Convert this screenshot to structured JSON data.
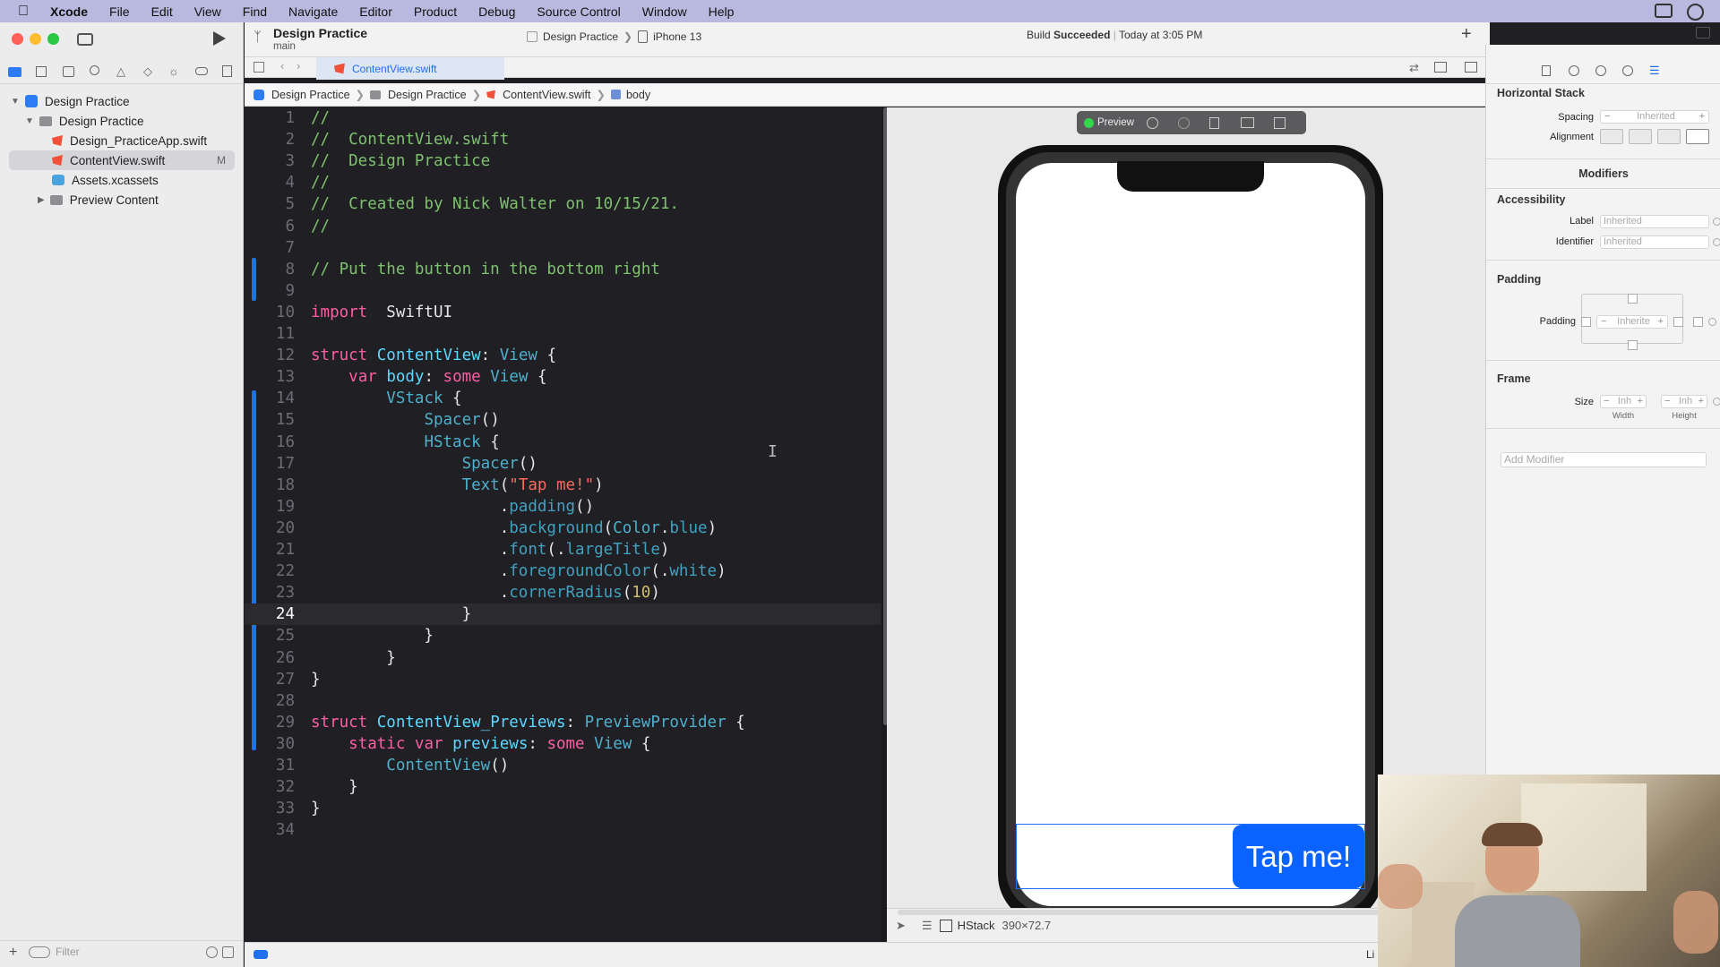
{
  "menubar": {
    "app": "Xcode",
    "items": [
      "File",
      "Edit",
      "View",
      "Find",
      "Navigate",
      "Editor",
      "Product",
      "Debug",
      "Source Control",
      "Window",
      "Help"
    ]
  },
  "toolbar": {
    "project_title": "Design Practice",
    "branch": "main",
    "scheme": "Design Practice",
    "device": "iPhone 13",
    "build_status_prefix": "Build ",
    "build_status_bold": "Succeeded",
    "build_time": "Today at 3:05 PM"
  },
  "tab": {
    "label": "ContentView.swift"
  },
  "breadcrumb": [
    "Design Practice",
    "Design Practice",
    "ContentView.swift",
    "body"
  ],
  "navigator": {
    "items": [
      {
        "label": "Design Practice",
        "kind": "project"
      },
      {
        "label": "Design Practice",
        "kind": "folder"
      },
      {
        "label": "Design_PracticeApp.swift",
        "kind": "swift"
      },
      {
        "label": "ContentView.swift",
        "kind": "swift",
        "badge": "M"
      },
      {
        "label": "Assets.xcassets",
        "kind": "assets"
      },
      {
        "label": "Preview Content",
        "kind": "folder"
      }
    ],
    "filter_placeholder": "Filter"
  },
  "code": {
    "current_line": 24,
    "line_numbers": [
      "1",
      "2",
      "3",
      "4",
      "5",
      "6",
      "7",
      "8",
      "9",
      "10",
      "11",
      "12",
      "13",
      "14",
      "15",
      "16",
      "17",
      "18",
      "19",
      "20",
      "21",
      "22",
      "23",
      "24",
      "25",
      "26",
      "27",
      "28",
      "29",
      "30",
      "31",
      "32",
      "33",
      "34"
    ],
    "lines": [
      [
        [
          "cm",
          "//"
        ]
      ],
      [
        [
          "cm",
          "//  ContentView.swift"
        ]
      ],
      [
        [
          "cm",
          "//  Design Practice"
        ]
      ],
      [
        [
          "cm",
          "//"
        ]
      ],
      [
        [
          "cm",
          "//  Created by Nick Walter on 10/15/21."
        ]
      ],
      [
        [
          "cm",
          "//"
        ]
      ],
      [],
      [
        [
          "cm",
          "// Put the button in the bottom right"
        ]
      ],
      [],
      [
        [
          "kw",
          "import"
        ],
        [
          "",
          "  SwiftUI"
        ]
      ],
      [],
      [
        [
          "kw",
          "struct"
        ],
        [
          "",
          " "
        ],
        [
          "ty",
          "ContentView"
        ],
        [
          "",
          ": "
        ],
        [
          "ty2",
          "View"
        ],
        [
          "",
          " {"
        ]
      ],
      [
        [
          "",
          "    "
        ],
        [
          "kw",
          "var"
        ],
        [
          "",
          " "
        ],
        [
          "ty",
          "body"
        ],
        [
          "",
          ": "
        ],
        [
          "kw",
          "some"
        ],
        [
          "",
          " "
        ],
        [
          "ty2",
          "View"
        ],
        [
          "",
          " {"
        ]
      ],
      [
        [
          "",
          "        "
        ],
        [
          "ty2",
          "VStack"
        ],
        [
          "",
          " {"
        ]
      ],
      [
        [
          "",
          "            "
        ],
        [
          "ty2",
          "Spacer"
        ],
        [
          "",
          "()"
        ]
      ],
      [
        [
          "",
          "            "
        ],
        [
          "ty2",
          "HStack"
        ],
        [
          "",
          " {"
        ]
      ],
      [
        [
          "",
          "                "
        ],
        [
          "ty2",
          "Spacer"
        ],
        [
          "",
          "()"
        ]
      ],
      [
        [
          "",
          "                "
        ],
        [
          "ty2",
          "Text"
        ],
        [
          "",
          "("
        ],
        [
          "st",
          "\"Tap me!\""
        ],
        [
          "",
          ")"
        ]
      ],
      [
        [
          "",
          "                    ."
        ],
        [
          "pr",
          "padding"
        ],
        [
          "",
          "()"
        ]
      ],
      [
        [
          "",
          "                    ."
        ],
        [
          "pr",
          "background"
        ],
        [
          "",
          "("
        ],
        [
          "ty2",
          "Color"
        ],
        [
          "",
          "."
        ],
        [
          "pr",
          "blue"
        ],
        [
          "",
          ")"
        ]
      ],
      [
        [
          "",
          "                    ."
        ],
        [
          "pr",
          "font"
        ],
        [
          "",
          "(."
        ],
        [
          "pr",
          "largeTitle"
        ],
        [
          "",
          ")"
        ]
      ],
      [
        [
          "",
          "                    ."
        ],
        [
          "pr",
          "foregroundColor"
        ],
        [
          "",
          "(."
        ],
        [
          "pr",
          "white"
        ],
        [
          "",
          ")"
        ]
      ],
      [
        [
          "",
          "                    ."
        ],
        [
          "pr",
          "cornerRadius"
        ],
        [
          "",
          "("
        ],
        [
          "nm",
          "10"
        ],
        [
          "",
          ")"
        ]
      ],
      [
        [
          "",
          "                }"
        ]
      ],
      [
        [
          "",
          "            }"
        ]
      ],
      [
        [
          "",
          "        }"
        ]
      ],
      [
        [
          "",
          "}"
        ]
      ],
      [],
      [
        [
          "kw",
          "struct"
        ],
        [
          "",
          " "
        ],
        [
          "ty",
          "ContentView_Previews"
        ],
        [
          "",
          ": "
        ],
        [
          "ty2",
          "PreviewProvider"
        ],
        [
          "",
          " {"
        ]
      ],
      [
        [
          "",
          "    "
        ],
        [
          "kw",
          "static"
        ],
        [
          "",
          " "
        ],
        [
          "kw",
          "var"
        ],
        [
          "",
          " "
        ],
        [
          "ty",
          "previews"
        ],
        [
          "",
          ": "
        ],
        [
          "kw",
          "some"
        ],
        [
          "",
          " "
        ],
        [
          "ty2",
          "View"
        ],
        [
          "",
          " {"
        ]
      ],
      [
        [
          "",
          "        "
        ],
        [
          "ty2",
          "ContentView"
        ],
        [
          "",
          "()"
        ]
      ],
      [
        [
          "",
          "    }"
        ]
      ],
      [
        [
          "",
          "}"
        ]
      ],
      []
    ]
  },
  "preview": {
    "toolbar_label": "Preview",
    "button_text": "Tap me!",
    "selection_name": "HStack",
    "selection_size": "390×72.7"
  },
  "inspector": {
    "section_title": "Horizontal Stack",
    "spacing_label": "Spacing",
    "spacing_value": "Inherited",
    "alignment_label": "Alignment",
    "modifiers_label": "Modifiers",
    "accessibility_label": "Accessibility",
    "label_label": "Label",
    "label_value": "Inherited",
    "identifier_label": "Identifier",
    "identifier_value": "Inherited",
    "padding_title": "Padding",
    "padding_label": "Padding",
    "padding_value": "Inherite",
    "frame_title": "Frame",
    "size_label": "Size",
    "width_value": "Inh",
    "height_value": "Inh",
    "width_caption": "Width",
    "height_caption": "Height",
    "add_modifier_placeholder": "Add Modifier"
  },
  "status": {
    "partial": "Li"
  },
  "colors": {
    "menubar": "#b9b8df",
    "editor_bg": "#1f1f24",
    "accent_blue": "#1f6ff0",
    "button_blue": "#0a62ff"
  }
}
